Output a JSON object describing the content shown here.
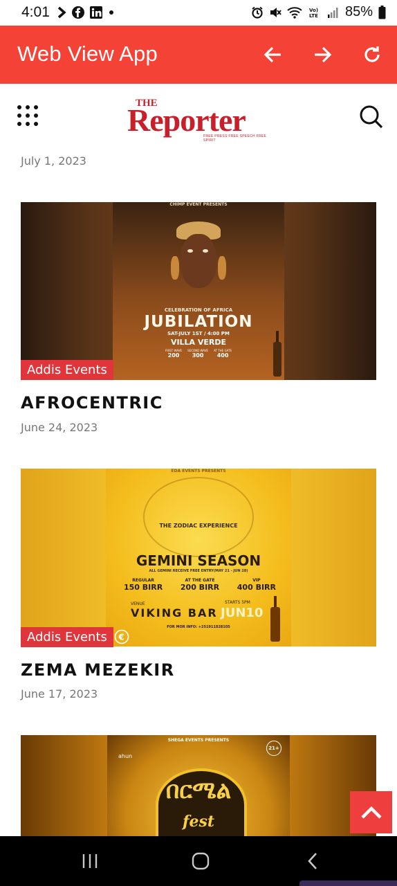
{
  "status_bar": {
    "time": "4:01",
    "battery": "85%",
    "left_icons": [
      "chevron-right-icon",
      "facebook-icon",
      "linkedin-icon",
      "dot-icon"
    ],
    "right_icons": [
      "alarm-icon",
      "mute-icon",
      "wifi-icon",
      "volte-icon",
      "signal-icon",
      "battery-icon"
    ]
  },
  "app_bar": {
    "title": "Web View App",
    "color": "#f44336"
  },
  "site_header": {
    "logo_small": "THE",
    "logo_word": "Reporter",
    "logo_tagline": "FREE PRESS  FREE SPEECH  FREE SPIRIT",
    "brand_color": "#c8202b"
  },
  "posts": [
    {
      "date": "July 1, 2023"
    },
    {
      "category": "Addis Events",
      "title": "AFROCENTRIC",
      "date": "June 24, 2023",
      "poster": {
        "top_line": "CHIMP EVENT PRESENTS",
        "subtitle": "CELEBRATION OF AFRICA",
        "headline": "JUBILATION",
        "when": "SAT-JULY 1ST / 4:00 PM",
        "venue": "VILLA VERDE",
        "prices": [
          {
            "label": "FIRST WAVE",
            "value": "200"
          },
          {
            "label": "SECOND WAVE",
            "value": "300"
          },
          {
            "label": "AT THE GATE",
            "value": "400"
          }
        ]
      }
    },
    {
      "category": "Addis Events",
      "title": "ZEMA MEZEKIR",
      "date": "June 17, 2023",
      "poster": {
        "top_line": "EDA EVENTS PRESENTS",
        "brand": "THE ZODIAC EXPERIENCE",
        "headline": "GEMINI SEASON",
        "sub": "ALL GEMINI RECEIVE FREE ENTRY(MAY 21 - JUN 28)",
        "prices": [
          {
            "label": "REGULAR",
            "value": "150 BIRR"
          },
          {
            "label": "AT THE GATE",
            "value": "200 BIRR"
          },
          {
            "label": "VIP",
            "value": "400 BIRR"
          }
        ],
        "venue_label": "VENUE",
        "venue": "VIKING BAR",
        "starts": "STARTS 5PM",
        "date": "JUN10",
        "info": "FOR MOR INFO: +251911828105"
      }
    },
    {
      "poster": {
        "top_line": "SHEGA EVENTS PRESENTS",
        "age": "21+",
        "brand": "ahun",
        "headline": "በርሜል",
        "script": "fest"
      }
    }
  ],
  "scroll_top_button": "chevron-up-icon",
  "nav_bar": [
    "recents-icon",
    "home-icon",
    "back-icon"
  ]
}
